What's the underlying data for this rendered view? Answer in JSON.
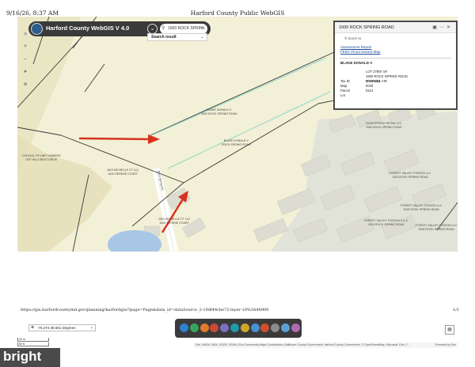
{
  "print_header": {
    "datetime": "9/16/26, 8:37 AM",
    "title": "Harford County Public WebGIS"
  },
  "app": {
    "title": "Harford County WebGIS V 4.0",
    "logo_icon": "county-seal-icon",
    "search_value": "1600 ROCK SPRIN...",
    "search_result_label": "Search result"
  },
  "popup": {
    "title": "1600 ROCK SPRING ROAD",
    "zoom_label": "Zoom to",
    "links": [
      "Assessment Report",
      "FEMA Flood Hazard Map"
    ],
    "owner": "BLAKE DONALD V",
    "address_lines": [
      "LOT 27897 SF",
      "1600 ROCK SPRING ROAD",
      "N OF BEL AIR"
    ],
    "fields": [
      {
        "key": "Tax ID",
        "value": "03045344"
      },
      {
        "key": "Map",
        "value": "0040"
      },
      {
        "key": "Parcel",
        "value": "0214"
      },
      {
        "key": "Lot",
        "value": ""
      }
    ]
  },
  "map_labels": {
    "blake_top": [
      "BLAKE DONALD V",
      "1600 ROCK SPRING ROAD"
    ],
    "blake_mid": [
      "BLAKE DONALD V",
      "ROCK SPRING ROAD"
    ],
    "council": [
      "COUNCIL OF UNIT OWNERS",
      "OFF HILLCREST DRIVE"
    ],
    "michelle": [
      "1610 MICHELLE CT LLC",
      "1610 SERENE COURT"
    ],
    "michelle2": [
      "1604 MICHELLE CT LLC",
      "1606 SERENE COURT"
    ],
    "street": "Rock Spring Rd",
    "rockspring_retail": [
      "ROCKSPRING RETAIL LLC",
      "1530 ROCK SPRING ROAD"
    ],
    "forest_valley_1": [
      "FOREST VALLEY STATION LLC",
      "1520 ROCK SPRING ROAD"
    ],
    "forest_valley_2": [
      "FOREST VALLEY STATION LLC",
      "1518 ROCK SPRING ROAD"
    ],
    "forest_valley_3": [
      "FOREST VALLEY STATION II LLC",
      "1510 ROCK SPRING ROAD"
    ],
    "forest_valley_4": [
      "FOREST VALLEY STATION LLC",
      "1506 ROCK SPRING ROAD"
    ]
  },
  "url": "https://gis.harfordcountymd.gov/planning/harfordgis/?page=Page&data_id=dataSource_2-19df44cbe72-layer-10%3A48900",
  "page_number": "1/1",
  "coordinates": "-76.374 39.561 Degrees",
  "scale_bar": [
    "20 m",
    "60 ft"
  ],
  "attribution": "Esri, NASA, NGA, USGS, FEMA | Esri Community Maps Contributors, Baltimore County Government, Harford County Government, © OpenStreetMap, Microsoft, Esri, T...",
  "powered_by": "Powered by Esri",
  "watermark": "bright",
  "toolbar_icons": [
    "layers-icon",
    "legend-icon",
    "basemap-icon",
    "bookmark-icon",
    "measure-icon",
    "draw-icon",
    "print-icon",
    "share-icon",
    "select-icon",
    "table-icon",
    "query-icon",
    "tools-icon"
  ],
  "colors": {
    "map_bg": "#f2f0d6",
    "parcel_line": "#3a3a3a",
    "highlight": "#8ed6c8",
    "arrow": "#d8321f",
    "header_bg": "#3a3a3a"
  }
}
